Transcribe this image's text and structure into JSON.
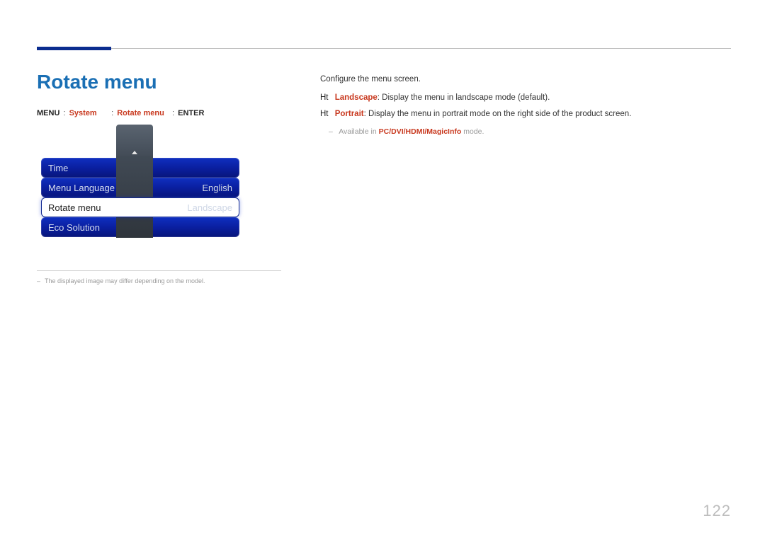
{
  "header": {
    "title": "Rotate menu"
  },
  "breadcrumb": {
    "menu": "MENU",
    "system": "System",
    "rotate": "Rotate menu",
    "enter": "ENTER"
  },
  "osd": {
    "rows": [
      {
        "label": "Time",
        "value": ""
      },
      {
        "label": "Menu Language",
        "value": "English"
      },
      {
        "label": "Rotate menu",
        "value": "Landscape"
      },
      {
        "label": "Eco Solution",
        "value": ""
      }
    ],
    "selected_index": 2
  },
  "footnote": "The displayed image may differ depending on the model.",
  "description": {
    "intro": "Configure the menu screen.",
    "items": [
      {
        "prefix": "Ht",
        "term": "Landscape",
        "text": ": Display the menu in landscape mode (default)."
      },
      {
        "prefix": "Ht",
        "term": "Portrait",
        "text": ": Display the menu in portrait mode on the right side of the product screen."
      }
    ],
    "sub_prefix": "Available in ",
    "sub_highlight": "PC/DVI/HDMI/MagicInfo",
    "sub_suffix": " mode."
  },
  "page_number": "122"
}
